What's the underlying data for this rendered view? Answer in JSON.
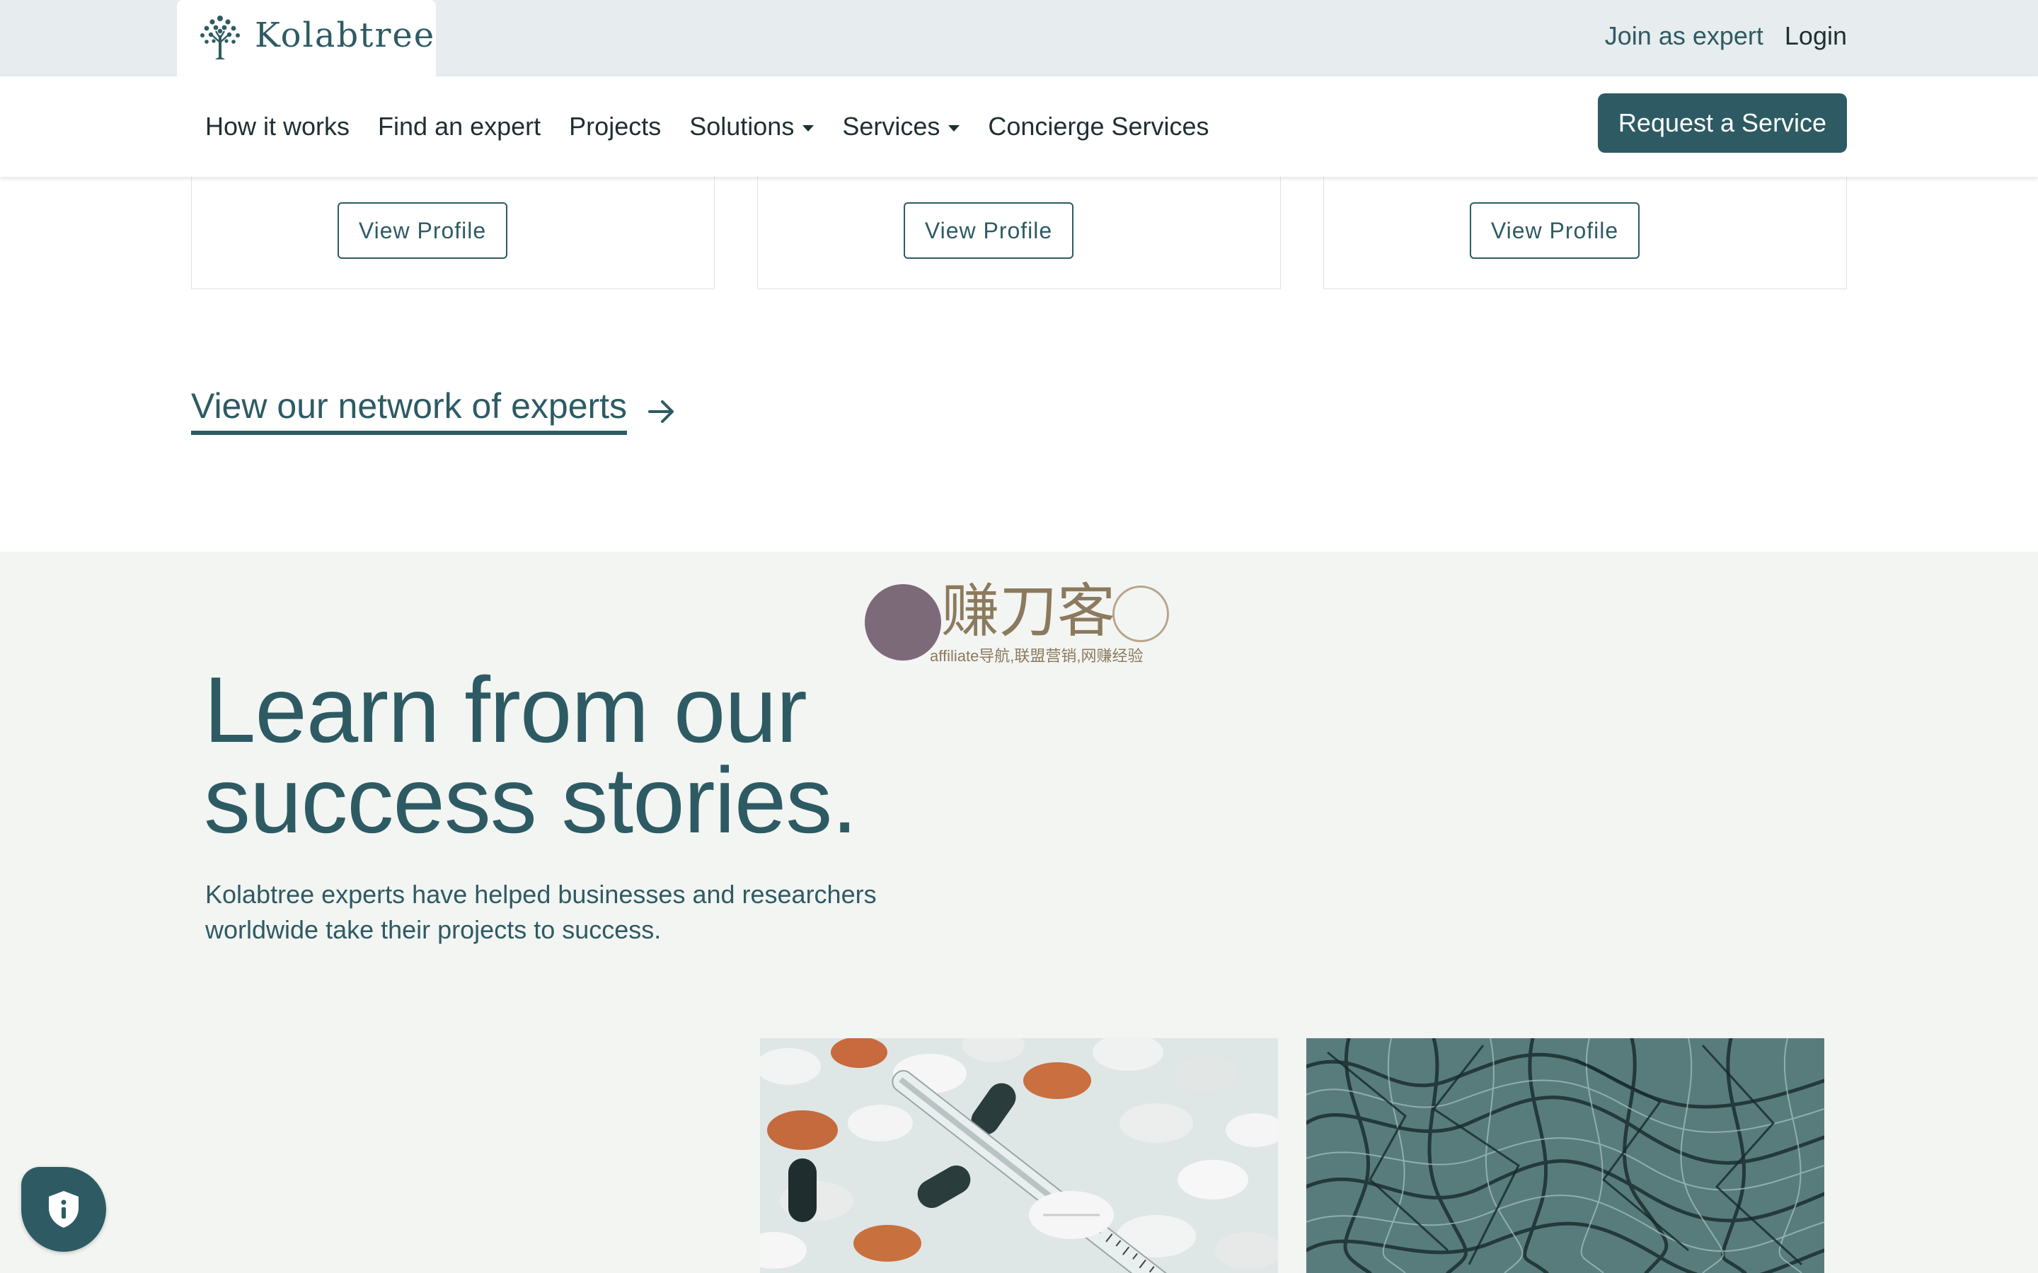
{
  "header": {
    "logo_text": "Kolabtree",
    "join_label": "Join as expert",
    "login_label": "Login"
  },
  "nav": {
    "items": [
      {
        "label": "How it works",
        "has_dropdown": false
      },
      {
        "label": "Find an expert",
        "has_dropdown": false
      },
      {
        "label": "Projects",
        "has_dropdown": false
      },
      {
        "label": "Solutions",
        "has_dropdown": true
      },
      {
        "label": "Services",
        "has_dropdown": true
      },
      {
        "label": "Concierge Services",
        "has_dropdown": false
      }
    ],
    "cta_label": "Request a Service"
  },
  "experts": {
    "cards": [
      {
        "button_label": "View Profile"
      },
      {
        "button_label": "View Profile"
      },
      {
        "button_label": "View Profile"
      }
    ],
    "network_link": "View our network of experts"
  },
  "watermark": {
    "title": "赚刀客",
    "subtitle": "affiliate导航,联盟营销,网赚经验"
  },
  "stories": {
    "title_line1": "Learn from our",
    "title_line2": "success stories.",
    "description": "Kolabtree experts have helped businesses and researchers worldwide take their projects to success."
  },
  "icons": {
    "logo": "tree-icon",
    "network_arrow": "arrow-right-icon",
    "privacy": "shield-info-icon"
  },
  "colors": {
    "brand": "#2e5b63",
    "topbar_bg": "#e7ecee",
    "section_bg": "#f3f5f3"
  }
}
